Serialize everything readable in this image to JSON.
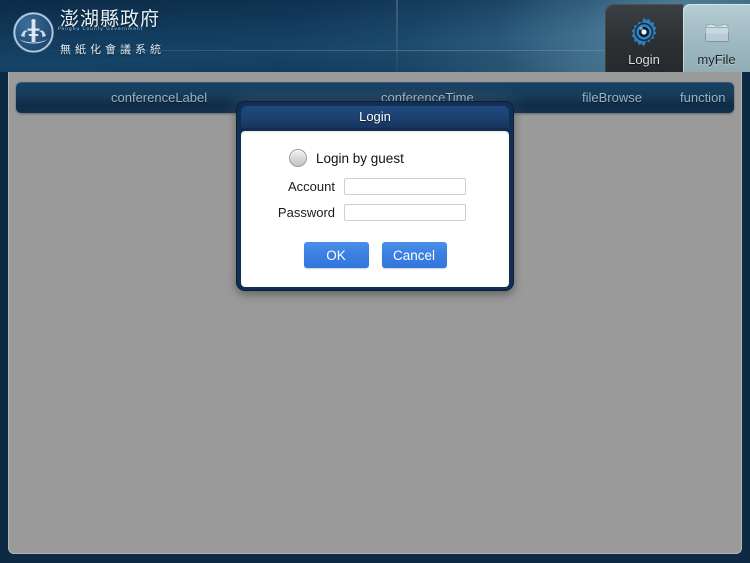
{
  "header": {
    "logo_icon": "penghu-county-emblem-icon",
    "title_cn": "澎湖縣政府",
    "title_romaji": "Penghu County Government",
    "subtitle_cn": "無紙化會議系統"
  },
  "tabs": [
    {
      "id": "login",
      "label": "Login",
      "icon": "gear-icon",
      "active": false
    },
    {
      "id": "myfile",
      "label": "myFile",
      "icon": "folder-icon",
      "active": true
    }
  ],
  "navbar": {
    "items": [
      {
        "id": "conference-label",
        "label": "conferenceLabel"
      },
      {
        "id": "conference-time",
        "label": "conferenceTime"
      },
      {
        "id": "file-browse",
        "label": "fileBrowse"
      },
      {
        "id": "function",
        "label": "function"
      }
    ]
  },
  "dialog": {
    "title": "Login",
    "guest": {
      "label": "Login by guest",
      "checked": false
    },
    "fields": [
      {
        "id": "account",
        "label": "Account",
        "value": "",
        "placeholder": ""
      },
      {
        "id": "password",
        "label": "Password",
        "value": "",
        "placeholder": ""
      }
    ],
    "buttons": [
      {
        "id": "ok",
        "label": "OK"
      },
      {
        "id": "cancel",
        "label": "Cancel"
      }
    ]
  },
  "colors": {
    "header_blue": "#123a5c",
    "navbar_blue": "#17405f",
    "panel_gray": "#9a9a9a",
    "dialog_border": "#112f52",
    "button_blue": "#3a7fe0",
    "tab_active": "#9fb9c2",
    "tab_inactive": "#2c3033"
  }
}
